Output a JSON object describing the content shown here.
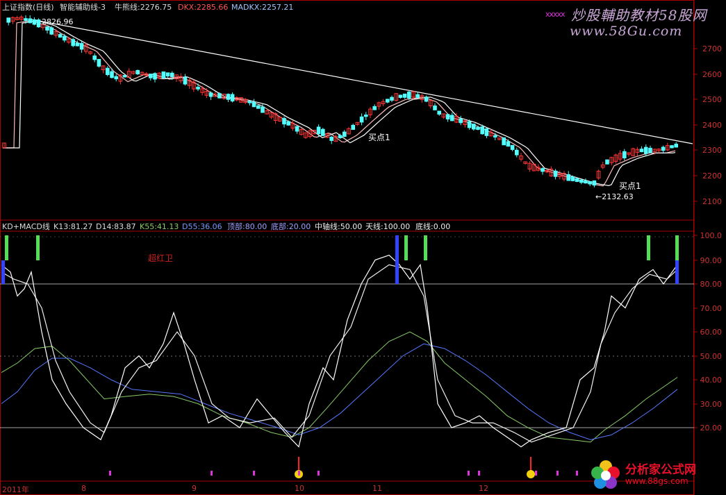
{
  "header": {
    "index_name": "上证指数(日线)",
    "indicator": "智能辅助线-3",
    "niu_label": "牛熊线:2276.75",
    "dkx_label": "DKX:2285.66",
    "madkx_label": "MADKX:2257.21"
  },
  "sub_header": {
    "name": "KD+MACD线",
    "k1": "K13:81.27",
    "d1": "D14:83.87",
    "k2": "K55:41.13",
    "d2": "D55:36.06",
    "top": "顶部:80.00",
    "bottom": "底部:20.00",
    "mid": "中轴线:50.00",
    "sky": "天线:100.00",
    "floor": "底线:0.00"
  },
  "annotations": {
    "high_price": "2826.96",
    "low_price": "←2132.63",
    "buy1_a": "买点1",
    "buy1_b": "买点1",
    "red_text": "超红卫"
  },
  "watermark": {
    "line1": "炒股輔助教材58股网",
    "line2": "www.58Gu.com",
    "dots": "xxxxx"
  },
  "logo": {
    "name": "分析家公式网",
    "url": "www.88gs.com"
  },
  "price_axis": [
    "2700",
    "2600",
    "2500",
    "2400",
    "2300",
    "2200",
    "2100"
  ],
  "osc_axis": [
    "100.0",
    "90.00",
    "80.00",
    "70.00",
    "60.00",
    "50.00",
    "40.00",
    "30.00",
    "20.00"
  ],
  "date_axis": [
    "2011年",
    "8",
    "9",
    "10",
    "11",
    "12"
  ],
  "colors": {
    "up": "#ff3333",
    "down": "#54ffff",
    "axis": "#c33",
    "white": "#ffffff",
    "green": "#55dd55",
    "blue_line": "#5577ff",
    "green_line": "#88cc66",
    "magenta": "#dd33dd",
    "dkx": "#ffbbbb"
  }
}
